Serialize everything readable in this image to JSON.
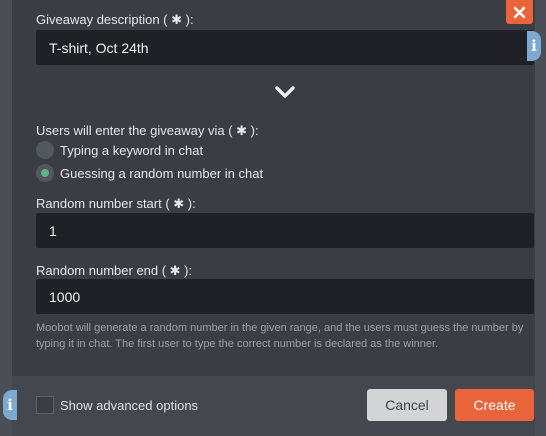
{
  "form": {
    "description_label": "Giveaway description ( ✱ ):",
    "description_value": "T-shirt, Oct 24th",
    "entry_label": "Users will enter the giveaway via ( ✱ ):",
    "entry_options": [
      {
        "label": "Typing a keyword in chat",
        "selected": false
      },
      {
        "label": "Guessing a random number in chat",
        "selected": true
      }
    ],
    "start_label": "Random number start ( ✱ ):",
    "start_value": "1",
    "end_label": "Random number end ( ✱ ):",
    "end_value": "1000",
    "help_text": "Moobot will generate a random number in the given range, and the users must guess the number by typing it in chat. The first user to type the correct number is declared as the winner."
  },
  "footer": {
    "advanced_label": "Show advanced options",
    "cancel_label": "Cancel",
    "create_label": "Create"
  },
  "icons": {
    "info": "i",
    "close": "close-icon",
    "chevron": "chevron-down-icon"
  },
  "colors": {
    "accent": "#e9633b",
    "info": "#7da8cf",
    "radio_selected": "#5cb57c",
    "modal_bg": "#3a3d43",
    "input_bg": "#202126"
  }
}
